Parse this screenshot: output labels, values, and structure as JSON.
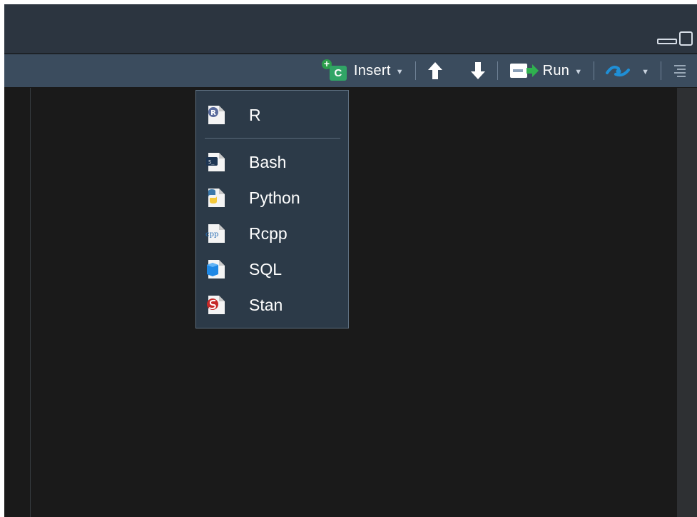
{
  "toolbar": {
    "insert": {
      "label": "Insert",
      "icon": "insert-chunk-icon",
      "badge": "C"
    },
    "move_up": {
      "icon": "arrow-up-icon"
    },
    "move_down": {
      "icon": "arrow-down-icon"
    },
    "run": {
      "label": "Run",
      "icon": "run-icon"
    },
    "publish": {
      "icon": "publish-icon"
    },
    "outline": {
      "icon": "outline-icon"
    }
  },
  "insert_menu": {
    "items": [
      {
        "label": "R",
        "icon": "r-file-icon"
      },
      {
        "label": "Bash",
        "icon": "bash-file-icon"
      },
      {
        "label": "Python",
        "icon": "python-file-icon"
      },
      {
        "label": "Rcpp",
        "icon": "rcpp-file-icon"
      },
      {
        "label": "SQL",
        "icon": "sql-file-icon"
      },
      {
        "label": "Stan",
        "icon": "stan-file-icon"
      }
    ]
  },
  "colors": {
    "toolbar_bg": "#3b4c5e",
    "topbar_bg": "#2c3540",
    "editor_bg": "#1a1a1a",
    "menu_bg": "#2c3a48",
    "accent_green": "#31a566",
    "accent_blue": "#1f8fd6"
  }
}
